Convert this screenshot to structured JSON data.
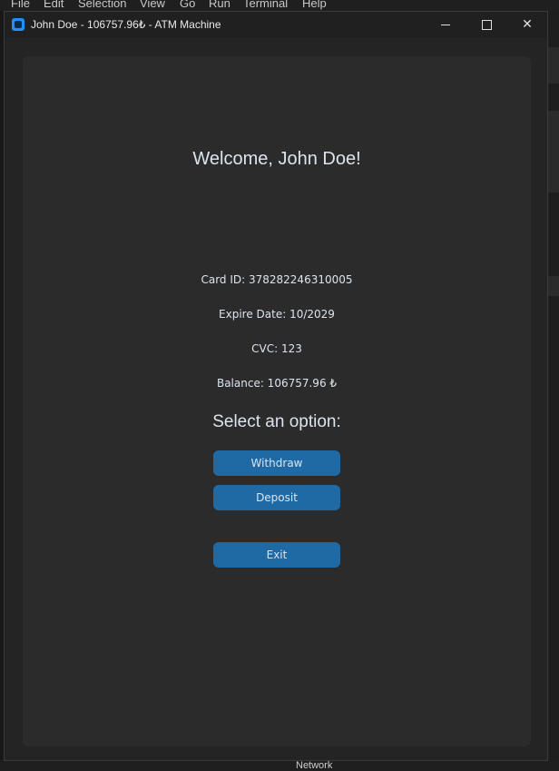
{
  "background_app": {
    "menu": [
      "File",
      "Edit",
      "Selection",
      "View",
      "Go",
      "Run",
      "Terminal",
      "Help"
    ],
    "status_item": "Network"
  },
  "window": {
    "title": "John Doe - 106757.96₺ - ATM Machine",
    "controls": {
      "minimize": "minimize",
      "maximize": "maximize",
      "close": "✕"
    }
  },
  "main": {
    "welcome": "Welcome, John Doe!",
    "card_id": "Card ID: 378282246310005",
    "expire_date": "Expire Date: 10/2029",
    "cvc": "CVC: 123",
    "balance": "Balance: 106757.96 ₺",
    "select_title": "Select an option:",
    "buttons": {
      "withdraw": "Withdraw",
      "deposit": "Deposit",
      "exit": "Exit"
    }
  },
  "colors": {
    "button": "#1f6aa5",
    "panel": "#2b2b2b",
    "window": "#242424",
    "text": "#dce4ee"
  }
}
